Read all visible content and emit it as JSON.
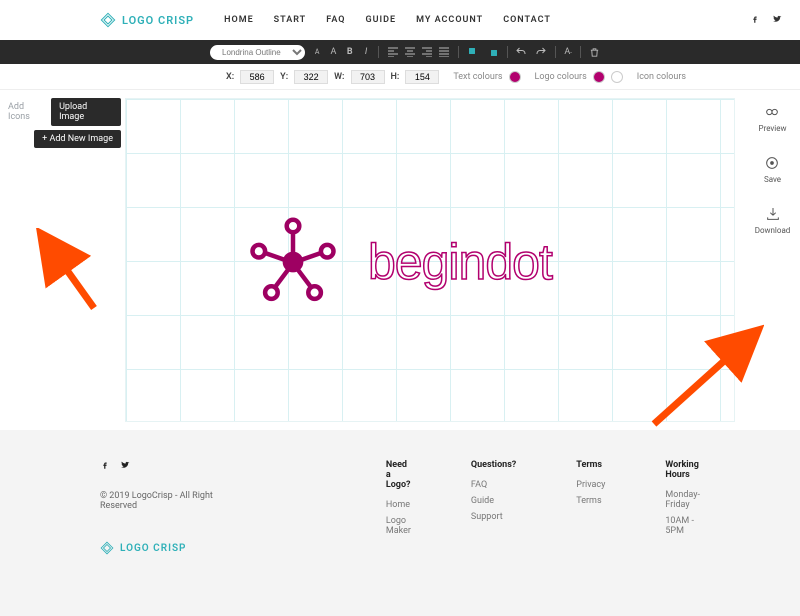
{
  "brand": "LOGO CRISP",
  "nav": [
    "HOME",
    "START",
    "FAQ",
    "GUIDE",
    "MY ACCOUNT",
    "CONTACT"
  ],
  "toolbar": {
    "font": "Londrina Outline"
  },
  "props": {
    "x_label": "X:",
    "x": "586",
    "y_label": "Y:",
    "y": "322",
    "w_label": "W:",
    "w": "703",
    "h_label": "H:",
    "h": "154",
    "text_colours": "Text colours",
    "logo_colours": "Logo colours",
    "icon_colours": "Icon colours",
    "accent": "#b2006e"
  },
  "left": {
    "add_icons": "Add Icons",
    "upload": "Upload Image",
    "add_new": "Add New Image"
  },
  "canvas": {
    "logo_text": "begindot"
  },
  "right": {
    "preview": "Preview",
    "save": "Save",
    "download": "Download"
  },
  "footer": {
    "copyright": "© 2019 LogoCrisp - All Right Reserved",
    "cols": [
      {
        "title": "Need a Logo?",
        "items": [
          "Home",
          "Logo Maker"
        ]
      },
      {
        "title": "Questions?",
        "items": [
          "FAQ",
          "Guide",
          "Support"
        ]
      },
      {
        "title": "Terms",
        "items": [
          "Privacy",
          "Terms"
        ]
      }
    ],
    "hours_title": "Working Hours",
    "hours_l1": "Monday-Friday",
    "hours_l2": "10AM - 5PM"
  }
}
